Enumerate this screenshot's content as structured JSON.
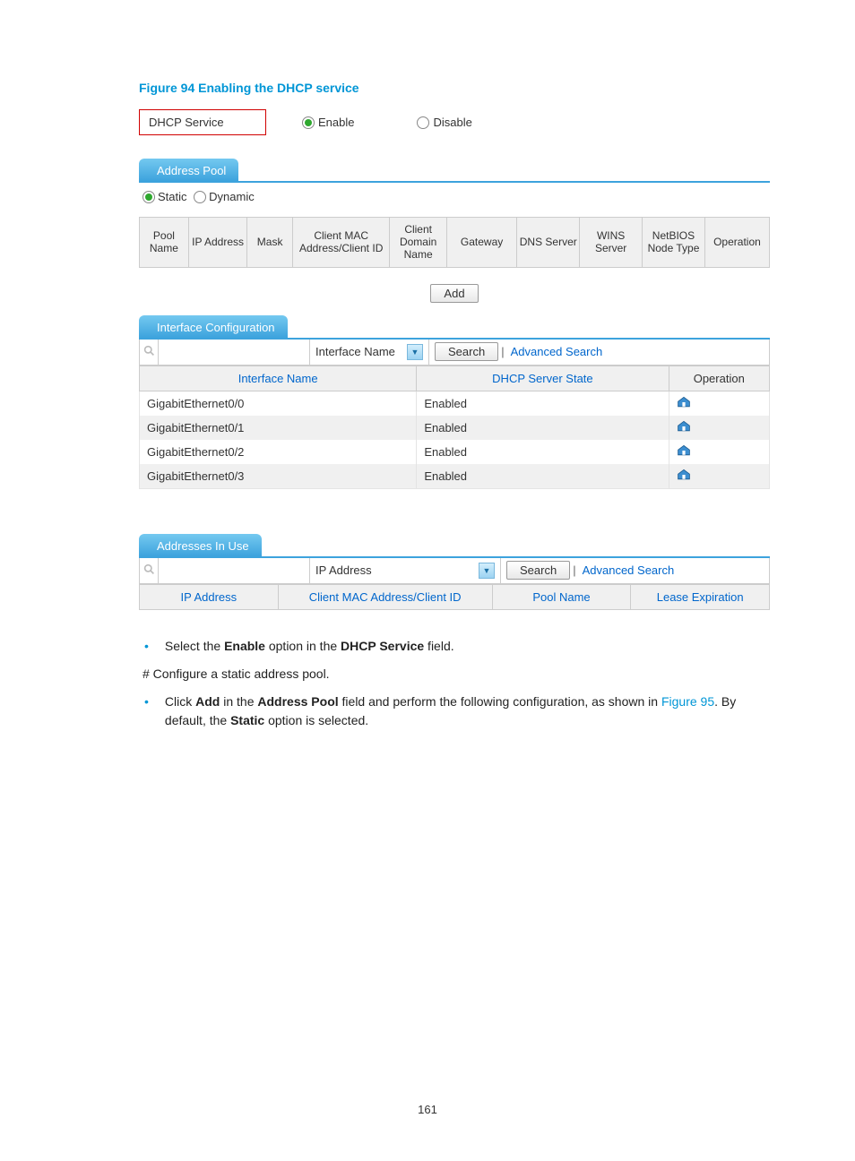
{
  "figure_title": "Figure 94 Enabling the DHCP service",
  "dhcp": {
    "label": "DHCP Service",
    "enable": "Enable",
    "disable": "Disable"
  },
  "address_pool": {
    "tab": "Address Pool",
    "static": "Static",
    "dynamic": "Dynamic",
    "headers": [
      "Pool Name",
      "IP Address",
      "Mask",
      "Client MAC Address/Client ID",
      "Client Domain Name",
      "Gateway",
      "DNS Server",
      "WINS Server",
      "NetBIOS Node Type",
      "Operation"
    ],
    "add_btn": "Add"
  },
  "iface_config": {
    "tab": "Interface Configuration",
    "dropdown": "Interface Name",
    "search_btn": "Search",
    "adv_search": "Advanced Search",
    "col_iface": "Interface Name",
    "col_state": "DHCP Server State",
    "col_op": "Operation",
    "rows": [
      {
        "name": "GigabitEthernet0/0",
        "state": "Enabled"
      },
      {
        "name": "GigabitEthernet0/1",
        "state": "Enabled"
      },
      {
        "name": "GigabitEthernet0/2",
        "state": "Enabled"
      },
      {
        "name": "GigabitEthernet0/3",
        "state": "Enabled"
      }
    ]
  },
  "inuse": {
    "tab": "Addresses In Use",
    "dropdown": "IP Address",
    "search_btn": "Search",
    "adv_search": "Advanced Search",
    "headers": [
      "IP Address",
      "Client MAC Address/Client ID",
      "Pool Name",
      "Lease Expiration"
    ]
  },
  "prose": {
    "b1_pre": "Select the ",
    "b1_enable": "Enable",
    "b1_mid": " option in the ",
    "b1_dhcp": "DHCP Service",
    "b1_post": " field.",
    "hash": "# Configure a static address pool.",
    "b2_pre": "Click ",
    "b2_add": "Add",
    "b2_mid": " in the ",
    "b2_pool": "Address Pool",
    "b2_mid2": " field and perform the following configuration, as shown in ",
    "b2_link": "Figure 95",
    "b2_post": ". By default, the ",
    "b2_static": "Static",
    "b2_end": " option is selected."
  },
  "page_number": "161"
}
